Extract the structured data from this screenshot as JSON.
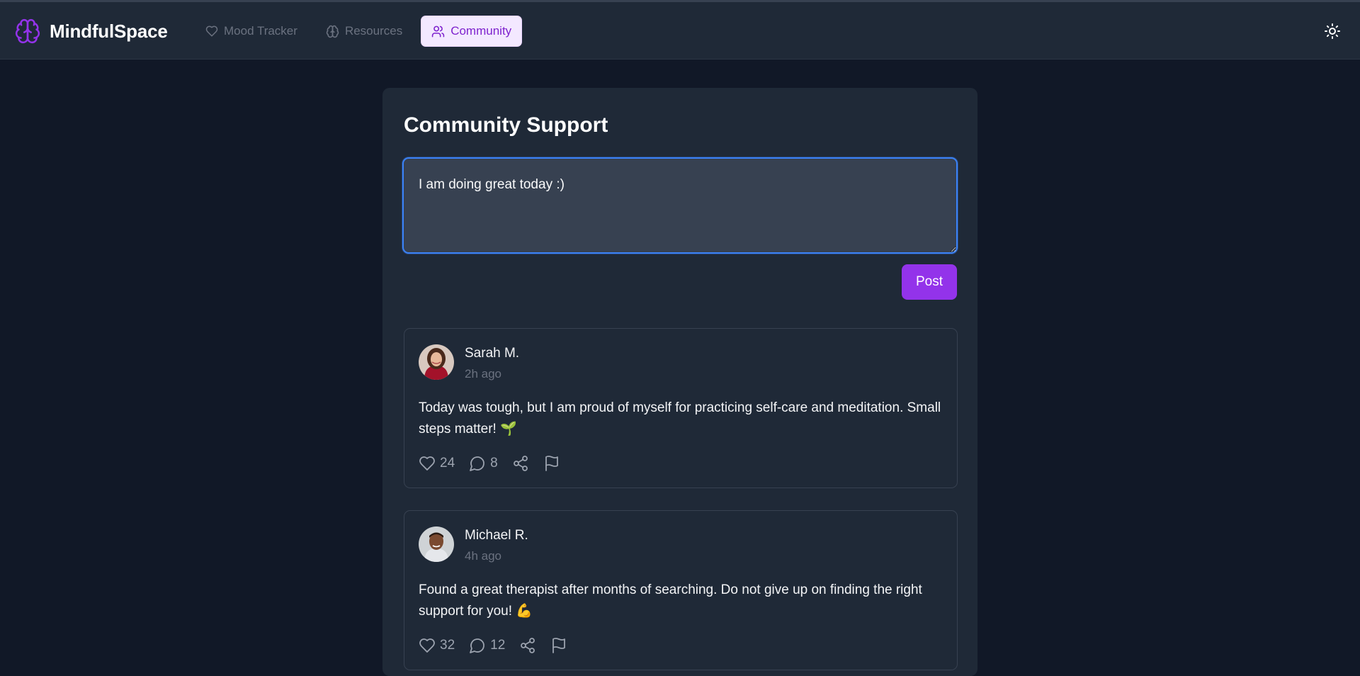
{
  "app": {
    "name": "MindfulSpace"
  },
  "nav": {
    "items": [
      {
        "label": "Mood Tracker",
        "icon": "heart-icon",
        "active": false
      },
      {
        "label": "Resources",
        "icon": "brain-icon",
        "active": false
      },
      {
        "label": "Community",
        "icon": "users-icon",
        "active": true
      }
    ]
  },
  "colors": {
    "accent": "#9333ea",
    "active_tab_bg": "#f3e8ff",
    "active_tab_text": "#7e22ce",
    "focus_ring": "#3b82f6",
    "page_bg": "#111827",
    "panel_bg": "#1f2937"
  },
  "main": {
    "title": "Community Support",
    "composer": {
      "value": "I am doing great today :)"
    },
    "post_button": "Post",
    "posts": [
      {
        "author": "Sarah M.",
        "time": "2h ago",
        "text": "Today was tough, but I am proud of myself for practicing self-care and meditation. Small steps matter! 🌱",
        "likes": "24",
        "comments": "8"
      },
      {
        "author": "Michael R.",
        "time": "4h ago",
        "text": "Found a great therapist after months of searching. Do not give up on finding the right support for you! 💪",
        "likes": "32",
        "comments": "12"
      }
    ]
  }
}
